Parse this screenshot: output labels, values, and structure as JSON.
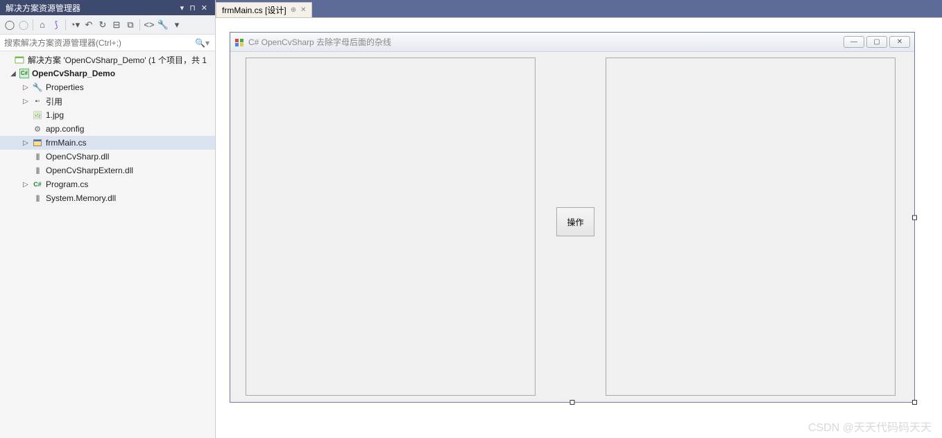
{
  "solutionExplorer": {
    "title": "解决方案资源管理器",
    "searchPlaceholder": "搜索解决方案资源管理器(Ctrl+;)",
    "tree": {
      "solutionLabel": "解决方案 'OpenCvSharp_Demo' (1 个项目，共 1",
      "projectName": "OpenCvSharp_Demo",
      "items": {
        "properties": "Properties",
        "references": "引用",
        "file_image": "1.jpg",
        "file_appconfig": "app.config",
        "file_frmmain": "frmMain.cs",
        "file_opencvsharp_dll": "OpenCvSharp.dll",
        "file_opencvsharpextern_dll": "OpenCvSharpExtern.dll",
        "file_program": "Program.cs",
        "file_systemmemory_dll": "System.Memory.dll"
      }
    }
  },
  "document": {
    "tabLabel": "frmMain.cs [设计]"
  },
  "form": {
    "title": "C# OpenCvSharp 去除字母后面的杂线",
    "actionButtonLabel": "操作"
  },
  "watermark": "CSDN @天天代码码天天"
}
